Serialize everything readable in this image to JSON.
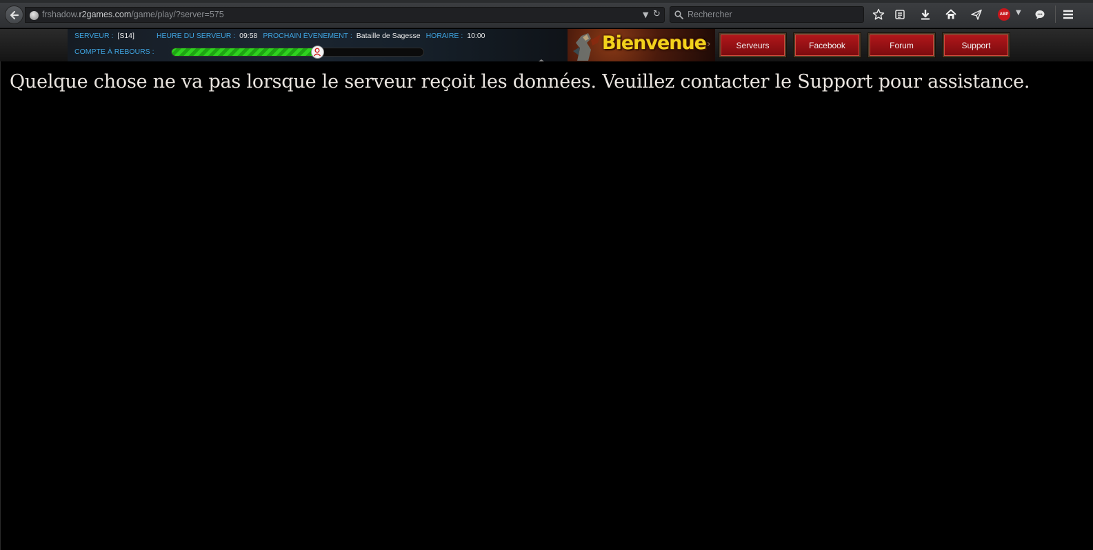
{
  "browser": {
    "url_prefix": "frshadow.",
    "url_host": "r2games.com",
    "url_path": "/game/play/?server=575",
    "search_placeholder": "Rechercher",
    "adblock_label": "ABP"
  },
  "game_info": {
    "server_label": "SERVEUR :",
    "server_value": "[S14]",
    "time_label": "HEURE DU SERVEUR :",
    "time_value": "09:58",
    "event_label": "PROCHAIN ÉVENEMENT :",
    "event_value": "Bataille de Sagesse",
    "schedule_label": "HORAIRE :",
    "schedule_value": "10:00",
    "countdown_label": "COMPTE À REBOURS :",
    "countdown_progress": 0.58
  },
  "banner": {
    "text": "Bienvenue"
  },
  "nav": {
    "buttons": [
      {
        "label": "Serveurs"
      },
      {
        "label": "Facebook"
      },
      {
        "label": "Forum"
      },
      {
        "label": "Support"
      }
    ]
  },
  "content": {
    "error_message": "Quelque chose ne va pas lorsque le serveur reçoit les données. Veuillez contacter le Support pour assistance."
  },
  "colors": {
    "label_blue": "#3fa4e0",
    "button_red": "#b2171b",
    "progress_green": "#2fd11f",
    "banner_yellow": "#f2d21c"
  }
}
